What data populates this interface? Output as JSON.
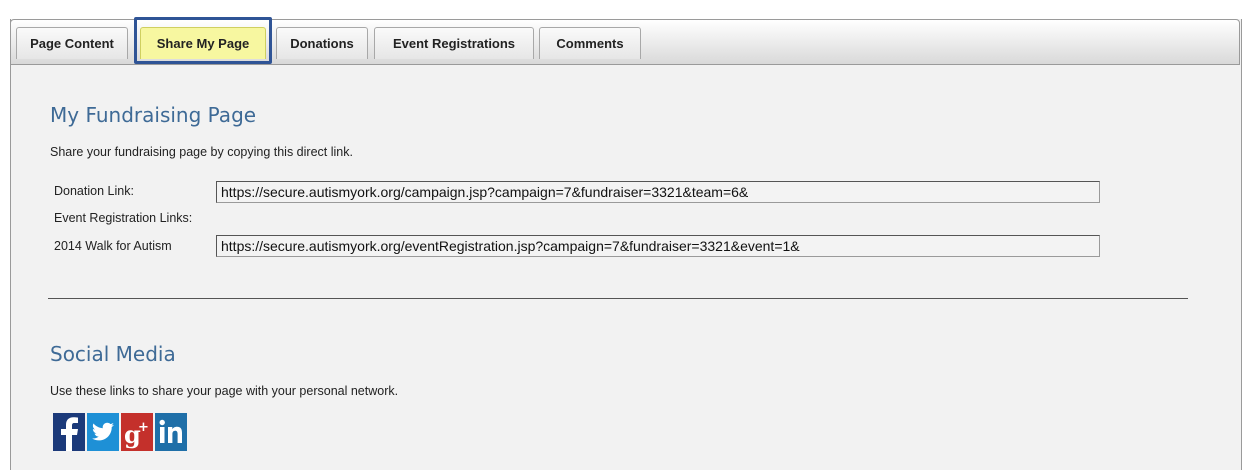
{
  "tabs": [
    {
      "label": "Page Content"
    },
    {
      "label": "Share My Page",
      "active": true
    },
    {
      "label": "Donations"
    },
    {
      "label": "Event Registrations"
    },
    {
      "label": "Comments"
    }
  ],
  "fundraising": {
    "title": "My Fundraising Page",
    "description": "Share your fundraising page by copying this direct link.",
    "donation_label": "Donation Link:",
    "donation_url": "https://secure.autismyork.org/campaign.jsp?campaign=7&fundraiser=3321&team=6&",
    "event_links_label": "Event Registration Links:",
    "event_label": "2014 Walk for Autism",
    "event_url": "https://secure.autismyork.org/eventRegistration.jsp?campaign=7&fundraiser=3321&event=1&"
  },
  "social": {
    "title": "Social Media",
    "description": "Use these links to share your page with your personal network.",
    "icons": [
      {
        "name": "facebook-icon",
        "glyph": "f",
        "color": "#1c3a7a"
      },
      {
        "name": "twitter-icon",
        "glyph": "t",
        "color": "#1e90d6"
      },
      {
        "name": "google-plus-icon",
        "glyph": "g+",
        "color": "#c4302b"
      },
      {
        "name": "linkedin-icon",
        "glyph": "in",
        "color": "#1f6fa8"
      }
    ]
  },
  "colors": {
    "accent_title": "#3e6a96",
    "active_tab": "#f7f7a0",
    "highlight_border": "#2f5496"
  }
}
